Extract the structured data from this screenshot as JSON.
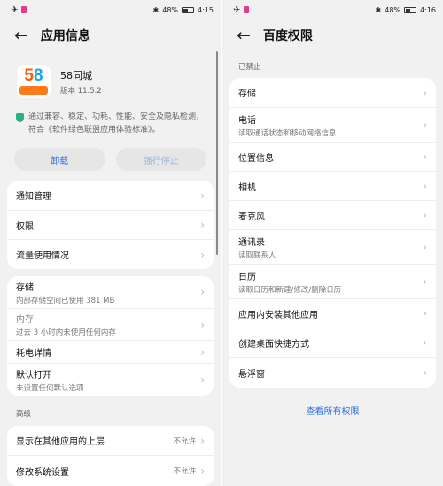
{
  "left": {
    "status": {
      "time": "4:15",
      "battery": "48%"
    },
    "title": "应用信息",
    "app": {
      "name": "58同城",
      "version": "版本 11.5.2"
    },
    "cert_text": "通过兼容、稳定、功耗、性能、安全及隐私检测，符合《软件绿色联盟应用体验标准》。",
    "buttons": {
      "uninstall": "卸载",
      "force_stop": "强行停止"
    },
    "group1": [
      "通知管理",
      "权限",
      "流量使用情况"
    ],
    "storage": {
      "label": "存储",
      "sub": "内部存储空间已使用 381 MB"
    },
    "memory": {
      "label": "内存",
      "sub": "过去 3 小时内未使用任何内存"
    },
    "battery_detail": "耗电详情",
    "default_open": {
      "label": "默认打开",
      "sub": "未设置任何默认选项"
    },
    "advanced_label": "高级",
    "overlay": {
      "label": "显示在其他应用的上层",
      "value": "不允许"
    },
    "modify_settings": {
      "label": "修改系统设置",
      "value": "不允许"
    }
  },
  "right": {
    "status": {
      "time": "4:16",
      "battery": "48%"
    },
    "title": "百度权限",
    "forbidden_label": "已禁止",
    "items": [
      {
        "label": "存储",
        "sub": ""
      },
      {
        "label": "电话",
        "sub": "读取通话状态和移动网络信息"
      },
      {
        "label": "位置信息",
        "sub": ""
      },
      {
        "label": "相机",
        "sub": ""
      },
      {
        "label": "麦克风",
        "sub": ""
      },
      {
        "label": "通讯录",
        "sub": "读取联系人"
      },
      {
        "label": "日历",
        "sub": "读取日历和新建/修改/删除日历"
      },
      {
        "label": "应用内安装其他应用",
        "sub": ""
      },
      {
        "label": "创建桌面快捷方式",
        "sub": ""
      },
      {
        "label": "悬浮窗",
        "sub": ""
      }
    ],
    "view_all": "查看所有权限"
  },
  "colors": {
    "accent": "#2f6fe0",
    "background": "#f1f1f1",
    "card": "#ffffff"
  }
}
